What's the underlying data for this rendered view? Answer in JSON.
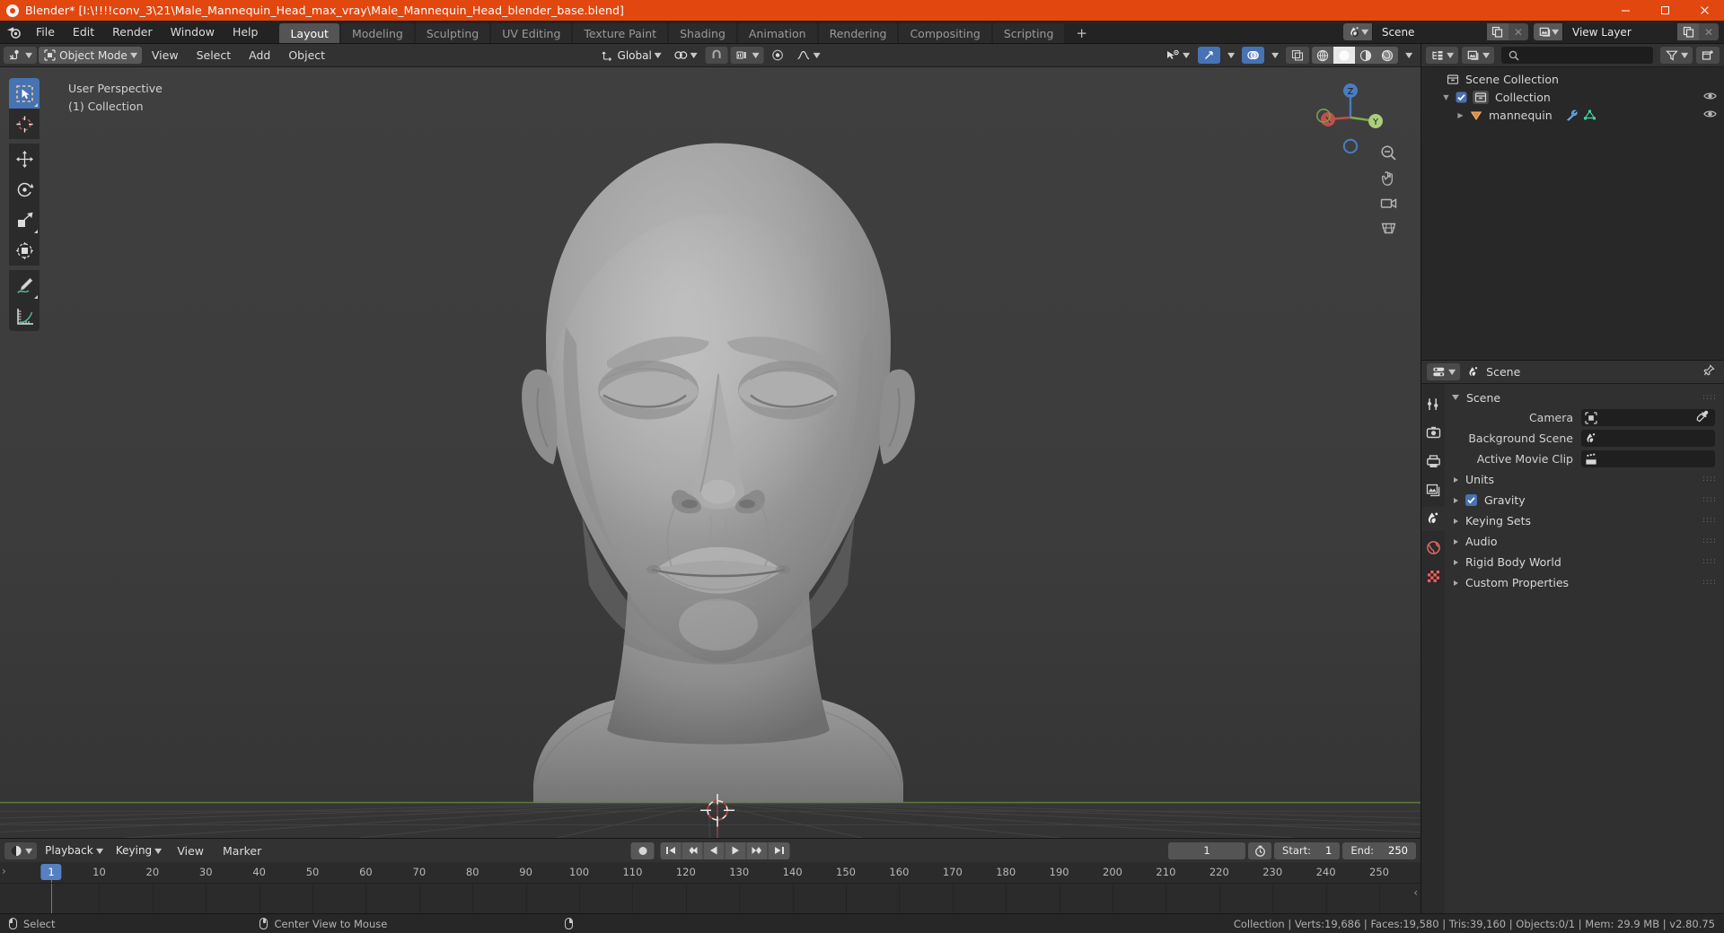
{
  "window": {
    "title": "Blender* [I:\\!!!!conv_3\\21\\Male_Mannequin_Head_max_vray\\Male_Mannequin_Head_blender_base.blend]",
    "minimize_label": "—",
    "maximize_label": "☐",
    "close_label": "✕",
    "titlebar_color": "#e2470f"
  },
  "topbar": {
    "menus": [
      "File",
      "Edit",
      "Render",
      "Window",
      "Help"
    ],
    "workspaces": [
      {
        "label": "Layout",
        "active": true
      },
      {
        "label": "Modeling",
        "active": false
      },
      {
        "label": "Sculpting",
        "active": false
      },
      {
        "label": "UV Editing",
        "active": false
      },
      {
        "label": "Texture Paint",
        "active": false
      },
      {
        "label": "Shading",
        "active": false
      },
      {
        "label": "Animation",
        "active": false
      },
      {
        "label": "Rendering",
        "active": false
      },
      {
        "label": "Compositing",
        "active": false
      },
      {
        "label": "Scripting",
        "active": false
      }
    ],
    "add_workspace_label": "+",
    "scene_name": "Scene",
    "view_layer_name": "View Layer"
  },
  "viewport": {
    "mode": "Object Mode",
    "menus": [
      "View",
      "Select",
      "Add",
      "Object"
    ],
    "transform_orientation": "Global",
    "overlay_line1": "User Perspective",
    "overlay_line2": "(1) Collection",
    "gizmo_axes": {
      "x": "X",
      "y": "Y",
      "z": "Z"
    },
    "tools": [
      {
        "name": "select-box-tool",
        "active": true
      },
      {
        "name": "cursor-tool",
        "active": false
      },
      {
        "name": "move-tool",
        "active": false
      },
      {
        "name": "rotate-tool",
        "active": false
      },
      {
        "name": "scale-tool",
        "active": false
      },
      {
        "name": "transform-tool",
        "active": false
      },
      {
        "name": "annotate-tool",
        "active": false
      },
      {
        "name": "measure-tool",
        "active": false
      }
    ],
    "shading_modes": [
      "wireframe",
      "solid",
      "material-preview",
      "rendered"
    ],
    "active_shading_mode": "solid"
  },
  "outliner": {
    "search_placeholder": "",
    "rows": [
      {
        "label": "Scene Collection",
        "indent": 0,
        "icon": "collection-icon",
        "has_checkbox": false,
        "has_disclosure": false,
        "has_eye": false,
        "modifiers": []
      },
      {
        "label": "Collection",
        "indent": 1,
        "icon": "collection-icon",
        "has_checkbox": true,
        "has_disclosure": true,
        "has_eye": true,
        "modifiers": []
      },
      {
        "label": "mannequin",
        "indent": 2,
        "icon": "mesh-object-icon",
        "has_checkbox": false,
        "has_disclosure": true,
        "has_eye": true,
        "modifiers": [
          "wrench-icon",
          "mesh-data-icon"
        ]
      }
    ]
  },
  "properties": {
    "breadcrumb": "Scene",
    "panel_title": "Scene",
    "fields": [
      {
        "label": "Camera",
        "value": "",
        "icon": "camera-icon",
        "has_eyedropper": true
      },
      {
        "label": "Background Scene",
        "value": "",
        "icon": "scene-icon",
        "has_eyedropper": false
      },
      {
        "label": "Active Movie Clip",
        "value": "",
        "icon": "clip-icon",
        "has_eyedropper": false
      }
    ],
    "sections": [
      {
        "label": "Units",
        "checkbox": null
      },
      {
        "label": "Gravity",
        "checkbox": true
      },
      {
        "label": "Keying Sets",
        "checkbox": null
      },
      {
        "label": "Audio",
        "checkbox": null
      },
      {
        "label": "Rigid Body World",
        "checkbox": null
      },
      {
        "label": "Custom Properties",
        "checkbox": null
      }
    ],
    "tabs": [
      {
        "name": "tool-tab",
        "active": false,
        "color": "#cfcfcf"
      },
      {
        "name": "render-tab",
        "active": false,
        "color": "#cfcfcf"
      },
      {
        "name": "output-tab",
        "active": false,
        "color": "#cfcfcf"
      },
      {
        "name": "view-layer-tab",
        "active": false,
        "color": "#cfcfcf"
      },
      {
        "name": "scene-tab",
        "active": true,
        "color": "#e8e8e8"
      },
      {
        "name": "world-tab",
        "active": false,
        "color": "#e06666"
      },
      {
        "name": "texture-tab",
        "active": false,
        "color": "#e06666"
      }
    ]
  },
  "timeline": {
    "menus": [
      "Playback",
      "Keying",
      "View",
      "Marker"
    ],
    "current_frame": "1",
    "start_label": "Start:",
    "start_value": "1",
    "end_label": "End:",
    "end_value": "250",
    "ticks": [
      {
        "label": "1",
        "frame": 1
      },
      {
        "label": "10",
        "frame": 10
      },
      {
        "label": "20",
        "frame": 20
      },
      {
        "label": "30",
        "frame": 30
      },
      {
        "label": "40",
        "frame": 40
      },
      {
        "label": "50",
        "frame": 50
      },
      {
        "label": "60",
        "frame": 60
      },
      {
        "label": "70",
        "frame": 70
      },
      {
        "label": "80",
        "frame": 80
      },
      {
        "label": "90",
        "frame": 90
      },
      {
        "label": "100",
        "frame": 100
      },
      {
        "label": "110",
        "frame": 110
      },
      {
        "label": "120",
        "frame": 120
      },
      {
        "label": "130",
        "frame": 130
      },
      {
        "label": "140",
        "frame": 140
      },
      {
        "label": "150",
        "frame": 150
      },
      {
        "label": "160",
        "frame": 160
      },
      {
        "label": "170",
        "frame": 170
      },
      {
        "label": "180",
        "frame": 180
      },
      {
        "label": "190",
        "frame": 190
      },
      {
        "label": "200",
        "frame": 200
      },
      {
        "label": "210",
        "frame": 210
      },
      {
        "label": "220",
        "frame": 220
      },
      {
        "label": "230",
        "frame": 230
      },
      {
        "label": "240",
        "frame": 240
      },
      {
        "label": "250",
        "frame": 250
      }
    ],
    "playhead_frame": 1,
    "transport": [
      "jump-to-start",
      "prev-keyframe",
      "play-reverse",
      "play",
      "next-keyframe",
      "jump-to-end"
    ]
  },
  "statusbar": {
    "hints": [
      {
        "mouse": "left",
        "label": "Select"
      },
      {
        "mouse": "middle",
        "label": "Center View to Mouse"
      },
      {
        "mouse": "right",
        "label": ""
      }
    ],
    "stats": "Collection | Verts:19,686 | Faces:19,580 | Tris:39,160 | Objects:0/1 | Mem: 29.9 MB | v2.80.75"
  }
}
